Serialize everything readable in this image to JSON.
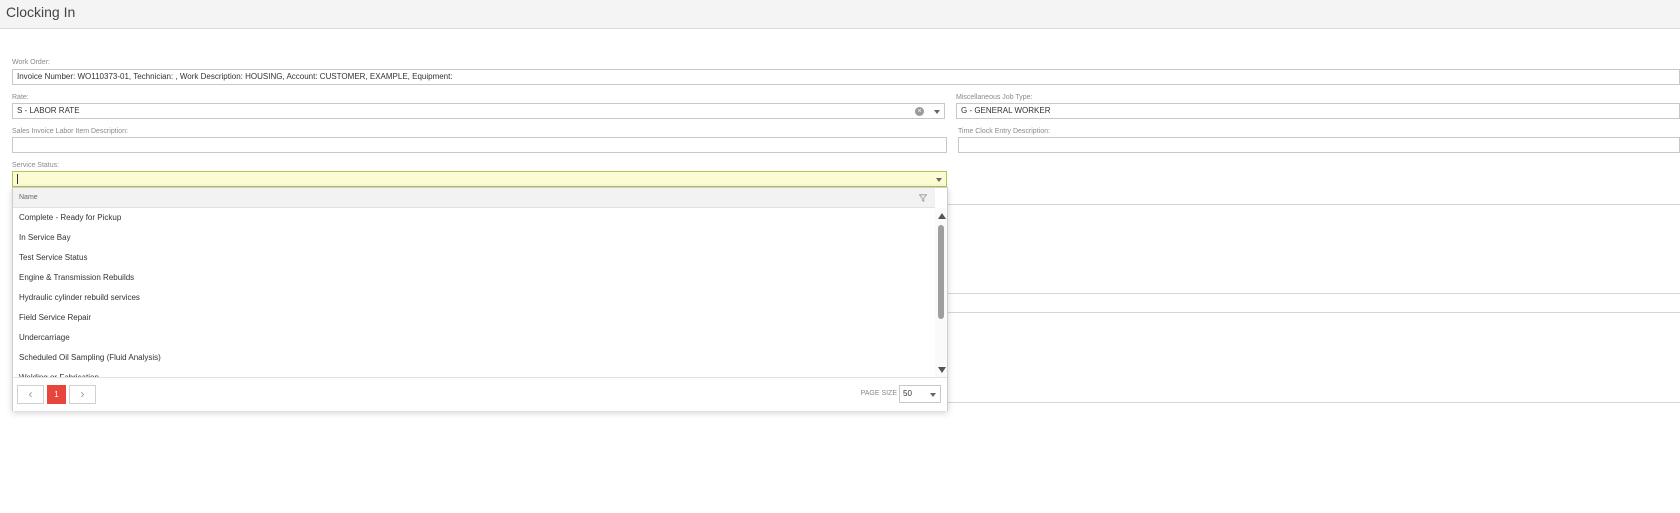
{
  "header": {
    "title": "Clocking In"
  },
  "form": {
    "work_order": {
      "label": "Work Order:",
      "value": "Invoice Number: WO110373-01, Technician: , Work Description: HOUSING, Account: CUSTOMER, EXAMPLE, Equipment:"
    },
    "rate": {
      "label": "Rate:",
      "value": "S - LABOR RATE"
    },
    "misc_job_type": {
      "label": "Miscellaneous Job Type:",
      "value": "G - GENERAL WORKER"
    },
    "sales_invoice_desc": {
      "label": "Sales Invoice Labor Item Description:",
      "value": ""
    },
    "time_clock_desc": {
      "label": "Time Clock Entry Description:",
      "value": ""
    },
    "service_status": {
      "label": "Service Status:",
      "value": ""
    }
  },
  "dropdown": {
    "column_header": "Name",
    "items": [
      "Complete - Ready for Pickup",
      "In Service Bay",
      "Test Service Status",
      "Engine & Transmission Rebuilds",
      "Hydraulic cylinder rebuild services",
      "Field Service Repair",
      "Undercarriage",
      "Scheduled Oil Sampling (Fluid Analysis)",
      "Welding or Fabrication"
    ],
    "pager": {
      "prev": "‹",
      "current_page": "1",
      "next": "›",
      "page_size_label": "PAGE SIZE",
      "page_size_value": "50"
    }
  },
  "icons": {
    "clear": "clear-icon",
    "dropdown": "chevron-down-icon",
    "filter": "filter-icon"
  },
  "colors": {
    "active_field": "#fbfcd2",
    "current_page": "#e8453c"
  }
}
